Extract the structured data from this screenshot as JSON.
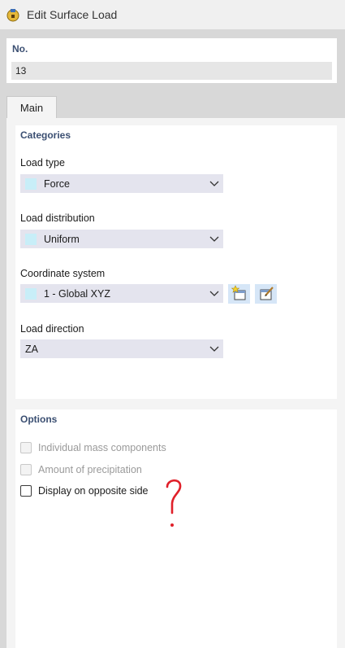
{
  "window": {
    "title": "Edit Surface Load",
    "icon": "surface-load-icon"
  },
  "number": {
    "label": "No.",
    "value": "13"
  },
  "tabs": [
    {
      "label": "Main",
      "active": true
    }
  ],
  "categories": {
    "title": "Categories",
    "load_type": {
      "label": "Load type",
      "value": "Force",
      "has_swatch": true
    },
    "load_distribution": {
      "label": "Load distribution",
      "value": "Uniform",
      "has_swatch": true
    },
    "coordinate_system": {
      "label": "Coordinate system",
      "value": "1 - Global XYZ",
      "has_swatch": true
    },
    "load_direction": {
      "label": "Load direction",
      "value": "ZA",
      "has_swatch": false
    }
  },
  "options": {
    "title": "Options",
    "items": [
      {
        "label": "Individual mass components",
        "checked": false,
        "enabled": false
      },
      {
        "label": "Amount of precipitation",
        "checked": false,
        "enabled": false
      },
      {
        "label": "Display on opposite side",
        "checked": false,
        "enabled": true
      }
    ]
  },
  "annotation": {
    "text": "?",
    "color": "#e0202a"
  },
  "colors": {
    "section_title": "#3b4f72",
    "combo_bg": "#e4e4ee",
    "swatch": "#c8eef8",
    "icon_button_bg": "#d6e6f7"
  }
}
